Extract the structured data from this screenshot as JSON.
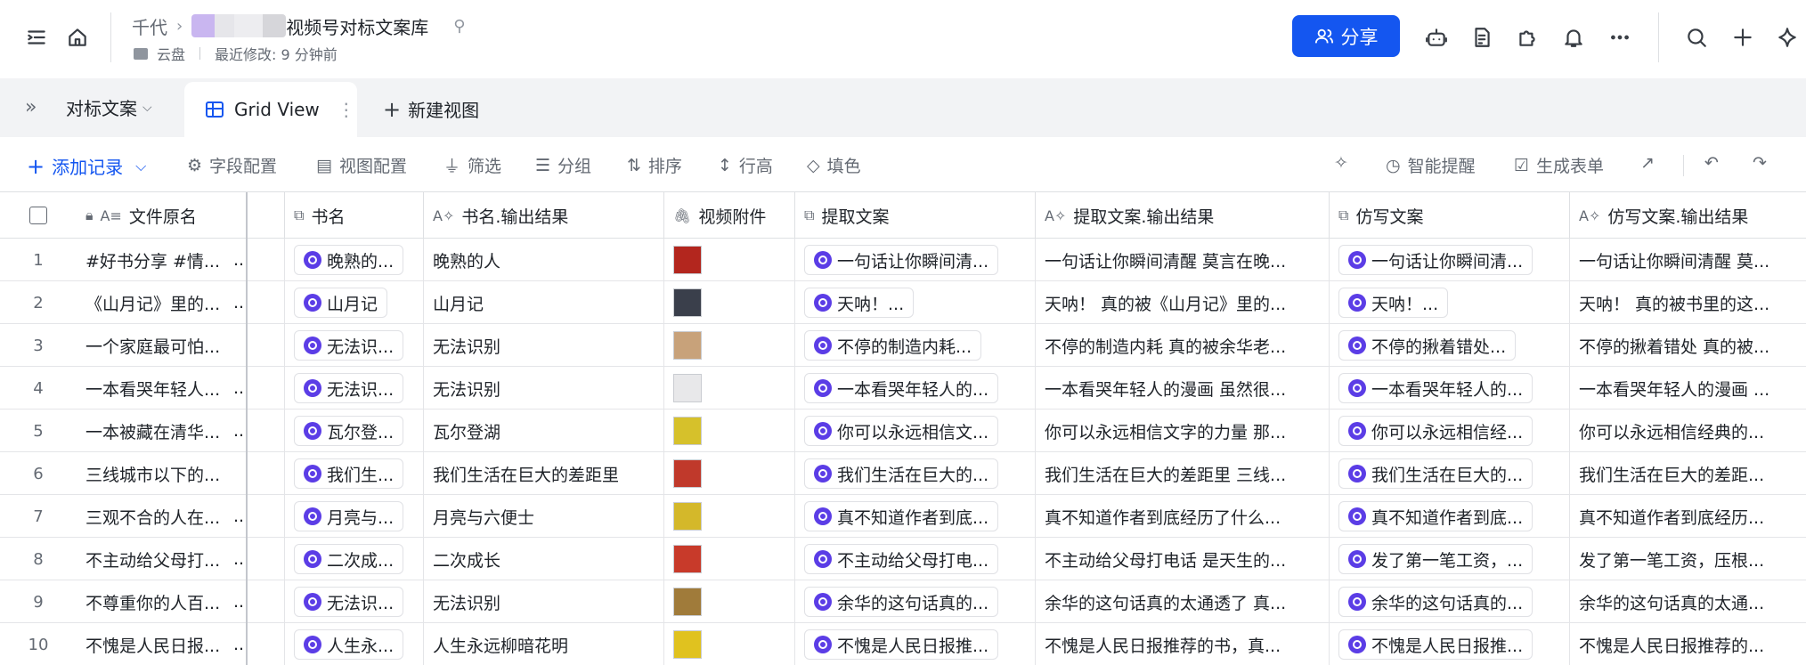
{
  "header": {
    "breadcrumb_root": "千代",
    "doc_title": "视频号对标文案库",
    "location": "云盘",
    "last_modified": "最近修改: 9 分钟前",
    "share_label": "分享"
  },
  "tabs": {
    "table_name": "对标文案",
    "view_name": "Grid View",
    "new_view": "新建视图"
  },
  "toolbar": {
    "add_record": "添加记录",
    "field_config": "字段配置",
    "view_config": "视图配置",
    "filter": "筛选",
    "group": "分组",
    "sort": "排序",
    "row_height": "行高",
    "fill": "填色",
    "smart_alert": "智能提醒",
    "generate_form": "生成表单"
  },
  "columns": {
    "file_name": "文件原名",
    "book": "书名",
    "book_output": "书名.输出结果",
    "video": "视频附件",
    "extract": "提取文案",
    "extract_output": "提取文案.输出结果",
    "rewrite": "仿写文案",
    "rewrite_output": "仿写文案.输出结果"
  },
  "thumb_colors": [
    "#b3261e",
    "#3a3f4b",
    "#c8a27a",
    "#e8e8ea",
    "#d6c12b",
    "#c0392b",
    "#d4b82a",
    "#c83a2a",
    "#a07b3a",
    "#e0c21f"
  ],
  "rows": [
    {
      "num": "1",
      "file": "#好书分享 #情...",
      "tail": "..",
      "book": "晚熟的...",
      "book_out": "晚熟的人",
      "extract": "一句话让你瞬间清...",
      "extract_out": "一句话让你瞬间清醒 莫言在晚...",
      "rewrite": "一句话让你瞬间清...",
      "rewrite_out": "一句话让你瞬间清醒 莫..."
    },
    {
      "num": "2",
      "file": "《山月记》里的...",
      "tail": "..",
      "book": "山月记",
      "book_out": "山月记",
      "extract": "天呐！...",
      "extract_out": "天呐！ 真的被《山月记》里的...",
      "rewrite": "天呐！...",
      "rewrite_out": "天呐！ 真的被书里的这..."
    },
    {
      "num": "3",
      "file": "一个家庭最可怕...",
      "tail": "",
      "book": "无法识...",
      "book_out": "无法识别",
      "extract": "不停的制造内耗...",
      "extract_out": "不停的制造内耗 真的被余华老...",
      "rewrite": "不停的揪着错处...",
      "rewrite_out": "不停的揪着错处 真的被..."
    },
    {
      "num": "4",
      "file": "一本看哭年轻人...",
      "tail": "..",
      "book": "无法识...",
      "book_out": "无法识别",
      "extract": "一本看哭年轻人的...",
      "extract_out": "一本看哭年轻人的漫画 虽然很...",
      "rewrite": "一本看哭年轻人的...",
      "rewrite_out": "一本看哭年轻人的漫画 ..."
    },
    {
      "num": "5",
      "file": "一本被藏在清华...",
      "tail": "..",
      "book": "瓦尔登...",
      "book_out": "瓦尔登湖",
      "extract": "你可以永远相信文...",
      "extract_out": "你可以永远相信文字的力量 那...",
      "rewrite": "你可以永远相信经...",
      "rewrite_out": "你可以永远相信经典的..."
    },
    {
      "num": "6",
      "file": "三线城市以下的...",
      "tail": "",
      "book": "我们生...",
      "book_out": "我们生活在巨大的差距里",
      "extract": "我们生活在巨大的...",
      "extract_out": "我们生活在巨大的差距里 三线...",
      "rewrite": "我们生活在巨大的...",
      "rewrite_out": "我们生活在巨大的差距..."
    },
    {
      "num": "7",
      "file": "三观不合的人在...",
      "tail": "..",
      "book": "月亮与...",
      "book_out": "月亮与六便士",
      "extract": "真不知道作者到底...",
      "extract_out": "真不知道作者到底经历了什么...",
      "rewrite": "真不知道作者到底...",
      "rewrite_out": "真不知道作者到底经历..."
    },
    {
      "num": "8",
      "file": "不主动给父母打...",
      "tail": "..",
      "book": "二次成...",
      "book_out": "二次成长",
      "extract": "不主动给父母打电...",
      "extract_out": "不主动给父母打电话 是天生的...",
      "rewrite": "发了第一笔工资，...",
      "rewrite_out": "发了第一笔工资，压根..."
    },
    {
      "num": "9",
      "file": "不尊重你的人百...",
      "tail": "..",
      "book": "无法识...",
      "book_out": "无法识别",
      "extract": "余华的这句话真的...",
      "extract_out": "余华的这句话真的太通透了 真...",
      "rewrite": "余华的这句话真的...",
      "rewrite_out": "余华的这句话真的太通..."
    },
    {
      "num": "10",
      "file": "不愧是人民日报...",
      "tail": "..",
      "book": "人生永...",
      "book_out": "人生永远柳暗花明",
      "extract": "不愧是人民日报推...",
      "extract_out": "不愧是人民日报推荐的书，真...",
      "rewrite": "不愧是人民日报推...",
      "rewrite_out": "不愧是人民日报推荐的..."
    }
  ]
}
